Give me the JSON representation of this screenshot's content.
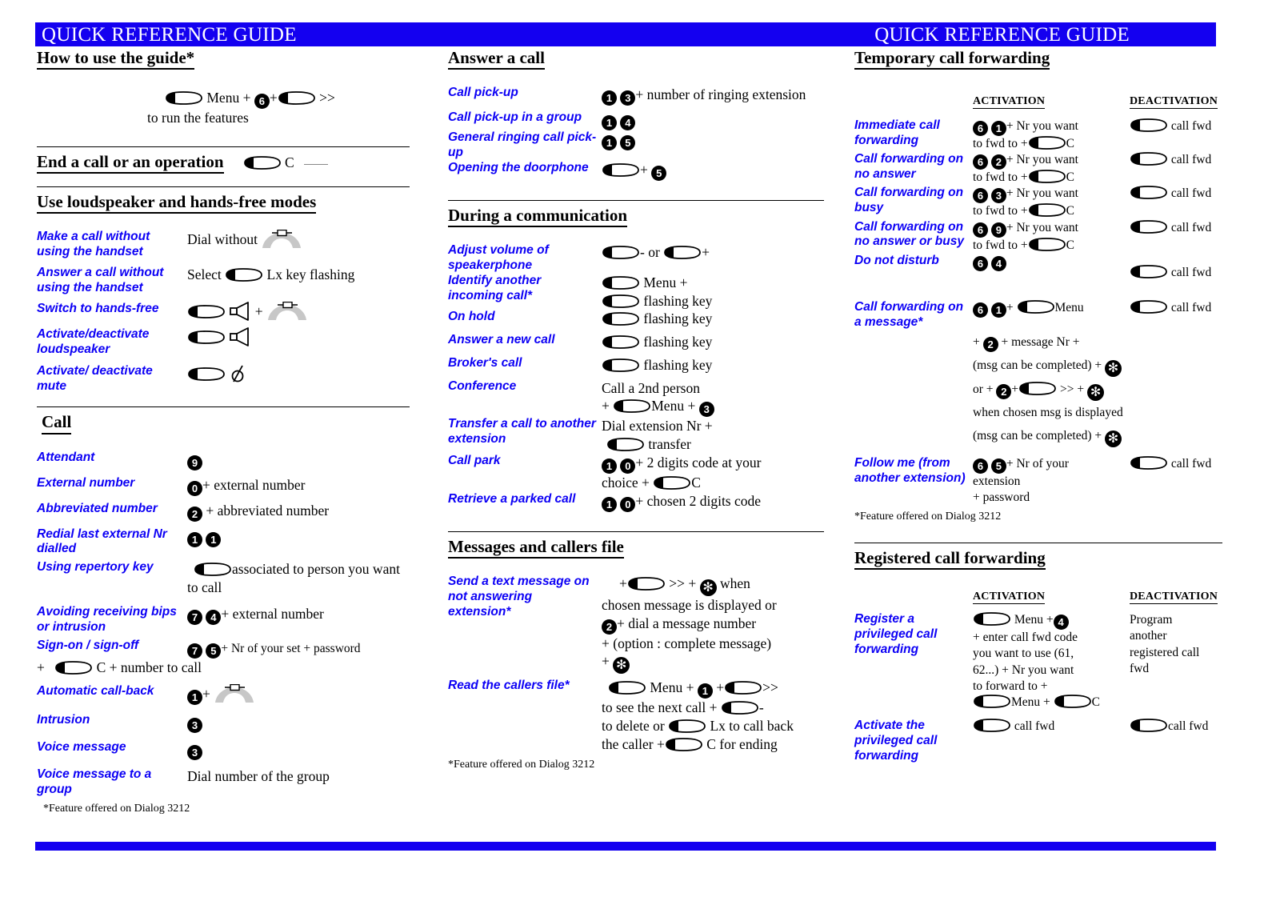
{
  "header": {
    "title_left": "QUICK REFERENCE GUIDE",
    "title_right": "QUICK REFERENCE GUIDE",
    "bar_color": "#1400f0"
  },
  "accent_blue": "#0c00f5",
  "col_a": {
    "s1": {
      "title": "How to use the guide*",
      "line1_menu": "Menu +",
      "line1_digit": "6",
      "line1_arrows": ">>",
      "line2": "to run  the features"
    },
    "s2": {
      "title": "End a call or an operation",
      "c": "C"
    },
    "s3": {
      "title": "Use loudspeaker and hands-free modes",
      "rows": [
        {
          "label": "Make a call without using the handset",
          "text": "Dial without"
        },
        {
          "label": "Answer a call without using the handset",
          "pre": "Select",
          "post": "Lx key flashing"
        },
        {
          "label": "Switch to hands-free",
          "plus": "+"
        },
        {
          "label": "Activate/deactivate loudspeaker"
        },
        {
          "label": "Activate/ deactivate mute"
        }
      ]
    },
    "s4": {
      "title": "Call",
      "rows": [
        {
          "label": "Attendant",
          "digits": [
            "9"
          ]
        },
        {
          "label": "External number",
          "digits": [
            "0"
          ],
          "text": "+ external number"
        },
        {
          "label": "Abbreviated number",
          "digits": [
            "2"
          ],
          "text": "+ abbreviated number"
        },
        {
          "label": "Redial last external Nr dialled",
          "digits": [
            "1",
            "1"
          ]
        },
        {
          "label": "Using repertory key",
          "text": "associated to person you want to call"
        },
        {
          "label": "Avoiding receiving bips or intrusion",
          "digits": [
            "7",
            "4"
          ],
          "text": "+ external number"
        },
        {
          "label": "Sign-on / sign-off",
          "digits": [
            "7",
            "5"
          ],
          "text": "+ Nr of your set +  password",
          "text2": "+",
          "text3": "C + number to call"
        },
        {
          "label": "Automatic call-back",
          "digits": [
            "1"
          ],
          "text": "+"
        },
        {
          "label": "Intrusion",
          "digits": [
            "3"
          ]
        },
        {
          "label": "Voice message",
          "digits": [
            "3"
          ]
        },
        {
          "label": "Voice message to a group",
          "text": "Dial number of the group"
        }
      ]
    },
    "footnote": "*Feature offered on Dialog 3212"
  },
  "col_b": {
    "s1": {
      "title": "Answer a call",
      "rows": [
        {
          "label": "Call pick-up",
          "digits": [
            "1",
            "3"
          ],
          "text": "+ number of ringing extension"
        },
        {
          "label": "Call pick-up in a group",
          "digits": [
            "1",
            "4"
          ]
        },
        {
          "label": "General ringing call pick-up",
          "digits": [
            "1",
            "5"
          ]
        },
        {
          "label": "Opening the doorphone",
          "text": "+",
          "digits": [
            "5"
          ]
        }
      ]
    },
    "s2": {
      "title": "During a communication",
      "rows": [
        {
          "label": "Adjust volume of speakerphone",
          "minus": "-",
          "or": "or",
          "plus": "+"
        },
        {
          "label": "Identify another incoming call*",
          "t1": "Menu +",
          "t2": "flashing key"
        },
        {
          "label": " On hold",
          "t1": "flashing key"
        },
        {
          "label": "Answer a new call",
          "t1": "flashing key"
        },
        {
          "label": "Broker's call",
          "t1": "flashing key"
        },
        {
          "label": "Conference",
          "t1": "Call a 2nd person",
          "t2plus": "+",
          "t2": "Menu +",
          "digits": [
            "3"
          ]
        },
        {
          "label": "Transfer a call to another extension",
          "t1": "Dial extension Nr +",
          "t2": "transfer"
        },
        {
          "label": "Call park",
          "digits": [
            "1",
            "0"
          ],
          "t1": "+ 2 digits code at your",
          "t2": "choice  +",
          "t3": "C"
        },
        {
          "label": "Retrieve a parked call",
          "digits": [
            "1",
            "0"
          ],
          "t1": "+ chosen 2 digits code"
        }
      ]
    },
    "s3": {
      "title": "Messages and callers file",
      "rows": [
        {
          "label": "Send a text message on not answering extension*",
          "l1a": "+",
          "l1b": ">> +",
          "l1c": "when",
          "l2": "chosen message is displayed or",
          "l3digit": "2",
          "l3": "+ dial a message number",
          "l4": "+ (option : complete message)",
          "l5": "+"
        },
        {
          "label": "Read the callers file*",
          "l1a": "Menu +",
          "l1digit": "1",
          "l1b": "+",
          "l1c": ">>",
          "l2": "to see the next call  +",
          "l2b": "-",
          "l3": "to delete or",
          "l3b": "Lx to call back",
          "l4": "the caller +",
          "l4b": "C for  ending"
        }
      ]
    },
    "footnote": "*Feature offered on Dialog 3212"
  },
  "col_c": {
    "s1": {
      "title": "Temporary call forwarding",
      "col_activation": "ACTIVATION",
      "col_deactivation": "DEACTIVATION",
      "rows": [
        {
          "label": "Immediate call forwarding",
          "digits": [
            "6",
            "1"
          ],
          "a1": "+ Nr you want",
          "a2": "to fwd to +",
          "a3": "C",
          "d": "call fwd"
        },
        {
          "label": "Call forwarding on no answer",
          "digits": [
            "6",
            "2"
          ],
          "a1": "+ Nr you want",
          "a2": "to fwd to +",
          "a3": "C",
          "d": "call fwd"
        },
        {
          "label": "Call forwarding on busy",
          "digits": [
            "6",
            "3"
          ],
          "a1": "+ Nr you want",
          "a2": "to fwd to +",
          "a3": "C",
          "d": "call fwd"
        },
        {
          "label": "Call forwarding on no answer or busy",
          "digits": [
            "6",
            "9"
          ],
          "a1": "+ Nr you want",
          "a2": "to fwd to +",
          "a3": "C",
          "d": "call fwd"
        },
        {
          "label": "Do not disturb",
          "digits": [
            "6",
            "4"
          ],
          "d": "call fwd"
        }
      ],
      "message_row": {
        "label": "Call forwarding on a message*",
        "digits": [
          "6",
          "1"
        ],
        "a1plus": "+",
        "a1": "Menu",
        "d": "call fwd",
        "a2plus": "+",
        "a2digit": "2",
        "a2": "+ message Nr +",
        "a3": "(msg can be completed) +",
        "a4pre": "or +",
        "a4digit": "2",
        "a4mid": "+",
        "a4post": ">> +",
        "a5": "when chosen msg is displayed",
        "a6": "(msg can be completed) +"
      },
      "follow_row": {
        "label": "Follow me (from another extension)",
        "digits": [
          "6",
          "5"
        ],
        "a1": "+ Nr of your",
        "a2": "extension",
        "a3": "+ password",
        "d": "call fwd"
      },
      "footnote": "*Feature offered on Dialog 3212"
    },
    "s2": {
      "title": "Registered call forwarding",
      "col_activation": "ACTIVATION",
      "col_deactivation": "DEACTIVATION",
      "register_row": {
        "label": " Register a privileged call forwarding",
        "a1": "Menu +",
        "a1digit": "4",
        "a2": "+ enter call fwd code",
        "a3": "you want to use (61,",
        "a4": "62...) + Nr you want",
        "a5": "to forward to +",
        "a6": "Menu +",
        "a7": "C",
        "d1": "Program",
        "d2": "another",
        "d3": "registered call",
        "d4": "fwd"
      },
      "activate_row": {
        "label": "Activate the privileged call forwarding",
        "a": "call fwd",
        "d": "call fwd"
      }
    }
  }
}
